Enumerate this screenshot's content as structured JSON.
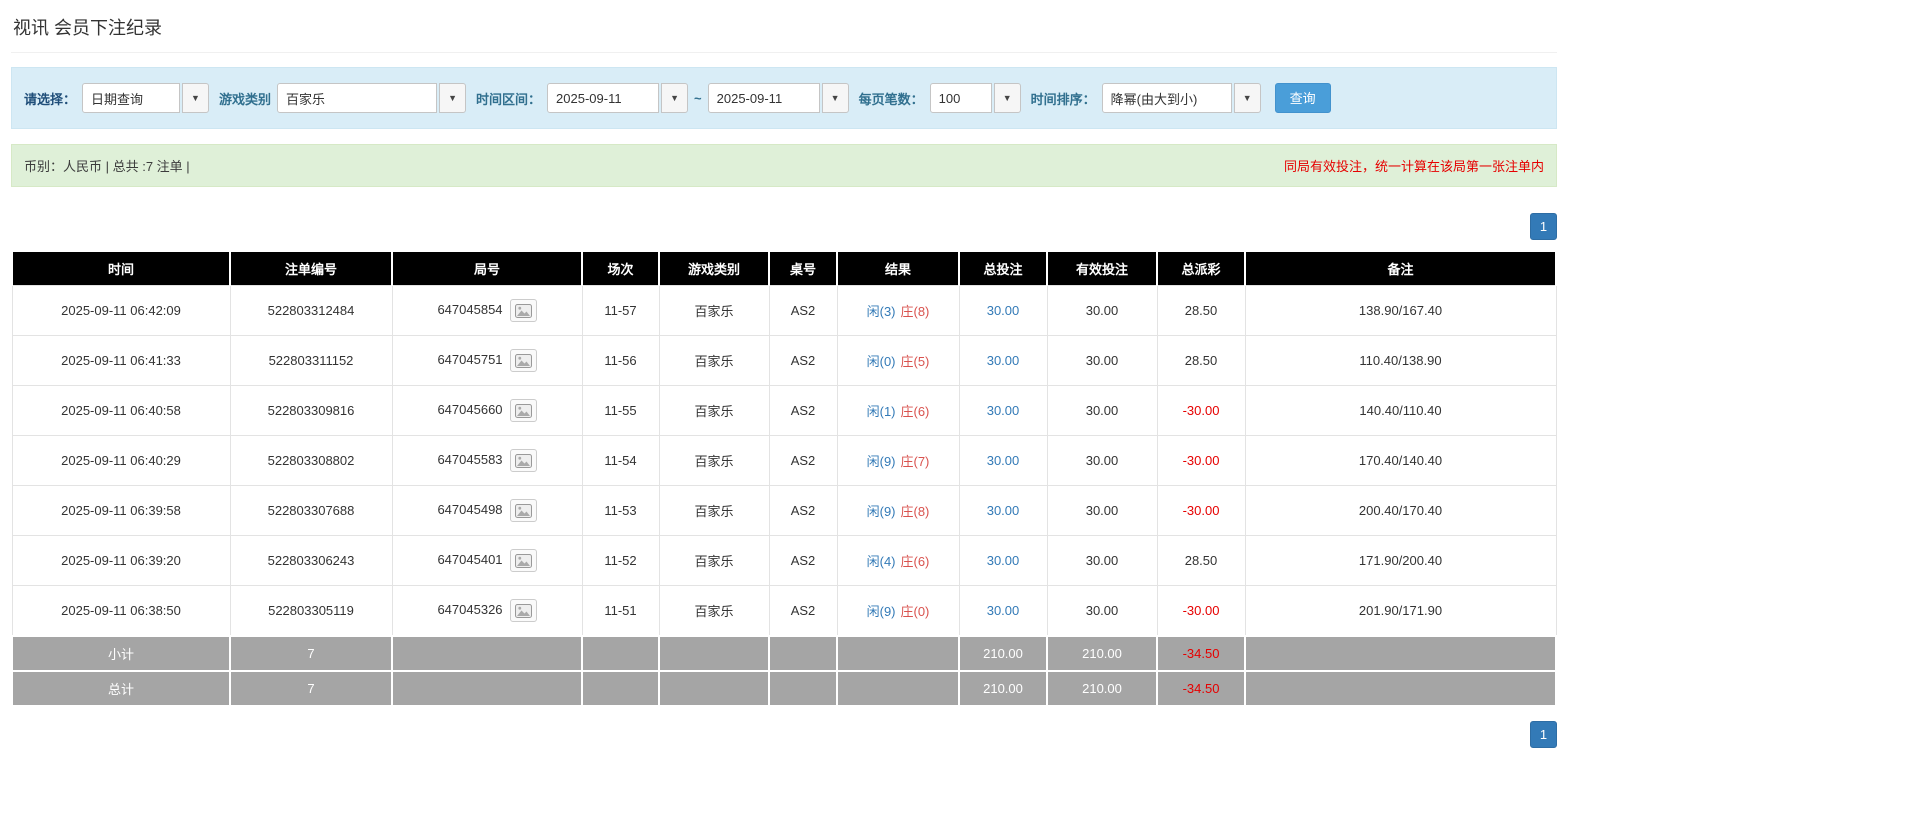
{
  "page": {
    "title": "视讯 会员下注纪录"
  },
  "filters": {
    "select_label": "请选择：",
    "select_value": "日期查询",
    "game_type_label": "游戏类别",
    "game_type_value": "百家乐",
    "time_range_label": "时间区间：",
    "date_from": "2025-09-11",
    "range_separator": "~",
    "date_to": "2025-09-11",
    "page_size_label": "每页笔数：",
    "page_size_value": "100",
    "sort_label": "时间排序：",
    "sort_value": "降幂(由大到小)",
    "search_button": "查询"
  },
  "summary": {
    "info": "币别：人民币 | 总共 :7 注单 |",
    "note": "同局有效投注，统一计算在该局第一张注单内"
  },
  "pagination": {
    "page": "1"
  },
  "colors": {
    "accent_blue": "#337ab7",
    "player_blue": "#337ab7",
    "banker_red": "#d9534f",
    "negative_red": "#e60000"
  },
  "table": {
    "headers": [
      "时间",
      "注单编号",
      "局号",
      "场次",
      "游戏类别",
      "桌号",
      "结果",
      "总投注",
      "有效投注",
      "总派彩",
      "备注"
    ],
    "rows": [
      {
        "time": "2025-09-11 06:42:09",
        "bet_id": "522803312484",
        "round_id": "647045854",
        "session": "11-57",
        "game": "百家乐",
        "table": "AS2",
        "result_player": "闲(3)",
        "result_banker": "庄(8)",
        "total_bet": "30.00",
        "valid_bet": "30.00",
        "payout": "28.50",
        "note": "138.90/167.40"
      },
      {
        "time": "2025-09-11 06:41:33",
        "bet_id": "522803311152",
        "round_id": "647045751",
        "session": "11-56",
        "game": "百家乐",
        "table": "AS2",
        "result_player": "闲(0)",
        "result_banker": "庄(5)",
        "total_bet": "30.00",
        "valid_bet": "30.00",
        "payout": "28.50",
        "note": "110.40/138.90"
      },
      {
        "time": "2025-09-11 06:40:58",
        "bet_id": "522803309816",
        "round_id": "647045660",
        "session": "11-55",
        "game": "百家乐",
        "table": "AS2",
        "result_player": "闲(1)",
        "result_banker": "庄(6)",
        "total_bet": "30.00",
        "valid_bet": "30.00",
        "payout": "-30.00",
        "note": "140.40/110.40"
      },
      {
        "time": "2025-09-11 06:40:29",
        "bet_id": "522803308802",
        "round_id": "647045583",
        "session": "11-54",
        "game": "百家乐",
        "table": "AS2",
        "result_player": "闲(9)",
        "result_banker": "庄(7)",
        "total_bet": "30.00",
        "valid_bet": "30.00",
        "payout": "-30.00",
        "note": "170.40/140.40"
      },
      {
        "time": "2025-09-11 06:39:58",
        "bet_id": "522803307688",
        "round_id": "647045498",
        "session": "11-53",
        "game": "百家乐",
        "table": "AS2",
        "result_player": "闲(9)",
        "result_banker": "庄(8)",
        "total_bet": "30.00",
        "valid_bet": "30.00",
        "payout": "-30.00",
        "note": "200.40/170.40"
      },
      {
        "time": "2025-09-11 06:39:20",
        "bet_id": "522803306243",
        "round_id": "647045401",
        "session": "11-52",
        "game": "百家乐",
        "table": "AS2",
        "result_player": "闲(4)",
        "result_banker": "庄(6)",
        "total_bet": "30.00",
        "valid_bet": "30.00",
        "payout": "28.50",
        "note": "171.90/200.40"
      },
      {
        "time": "2025-09-11 06:38:50",
        "bet_id": "522803305119",
        "round_id": "647045326",
        "session": "11-51",
        "game": "百家乐",
        "table": "AS2",
        "result_player": "闲(9)",
        "result_banker": "庄(0)",
        "total_bet": "30.00",
        "valid_bet": "30.00",
        "payout": "-30.00",
        "note": "201.90/171.90"
      }
    ],
    "subtotal": {
      "label": "小计",
      "count": "7",
      "total_bet": "210.00",
      "valid_bet": "210.00",
      "payout": "-34.50"
    },
    "total": {
      "label": "总计",
      "count": "7",
      "total_bet": "210.00",
      "valid_bet": "210.00",
      "payout": "-34.50"
    }
  }
}
